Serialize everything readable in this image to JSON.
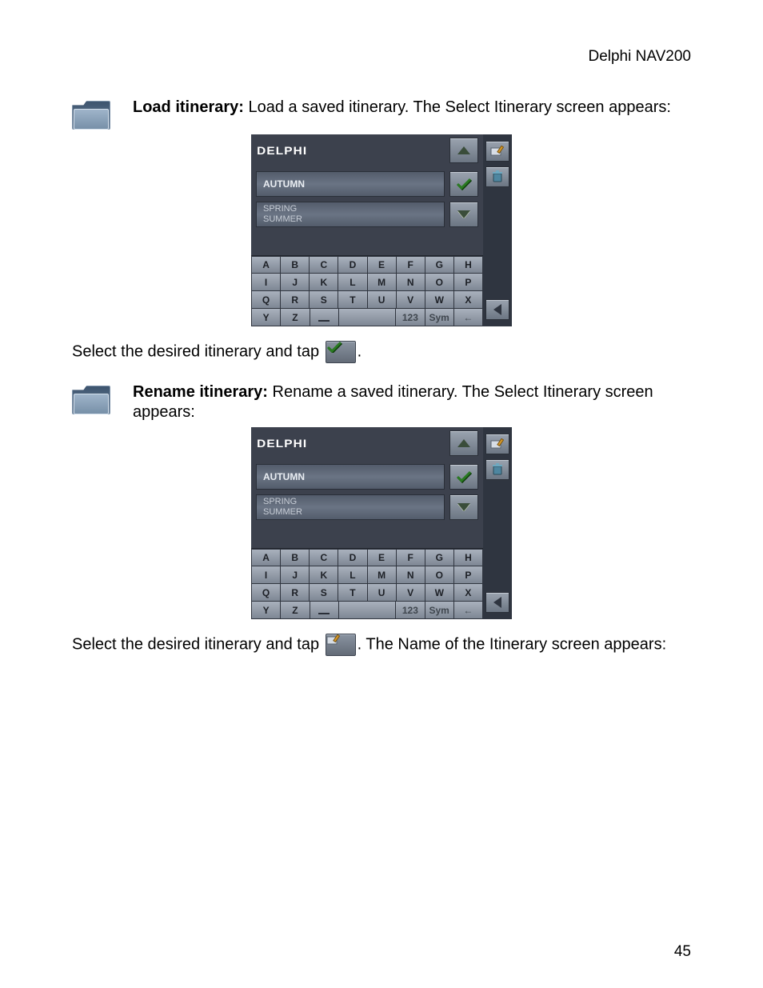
{
  "header": {
    "product": "Delphi NAV200"
  },
  "page_number": "45",
  "sections": {
    "load": {
      "title": "Load itinerary:",
      "body": " Load a saved itinerary. The Select Itinerary screen appears:",
      "after_pre": "Select the desired itinerary and tap ",
      "after_post": "."
    },
    "rename": {
      "title": "Rename itinerary:",
      "body": " Rename a saved itinerary. The Select Itinerary screen appears:",
      "after_pre": "Select the desired itinerary and tap ",
      "after_post": ". The Name of the Itinerary screen appears:"
    }
  },
  "device": {
    "brand": "DELPHI",
    "selected_item": "AUTUMN",
    "other_items": [
      "SPRING",
      "SUMMER"
    ],
    "keyboard": {
      "row1": [
        "A",
        "B",
        "C",
        "D",
        "E",
        "F",
        "G",
        "H"
      ],
      "row2": [
        "I",
        "J",
        "K",
        "L",
        "M",
        "N",
        "O",
        "P"
      ],
      "row3": [
        "Q",
        "R",
        "S",
        "T",
        "U",
        "V",
        "W",
        "X"
      ],
      "row4_letters": [
        "Y",
        "Z"
      ],
      "row4_num": "123",
      "row4_sym": "Sym",
      "row4_back_glyph": "←"
    }
  }
}
